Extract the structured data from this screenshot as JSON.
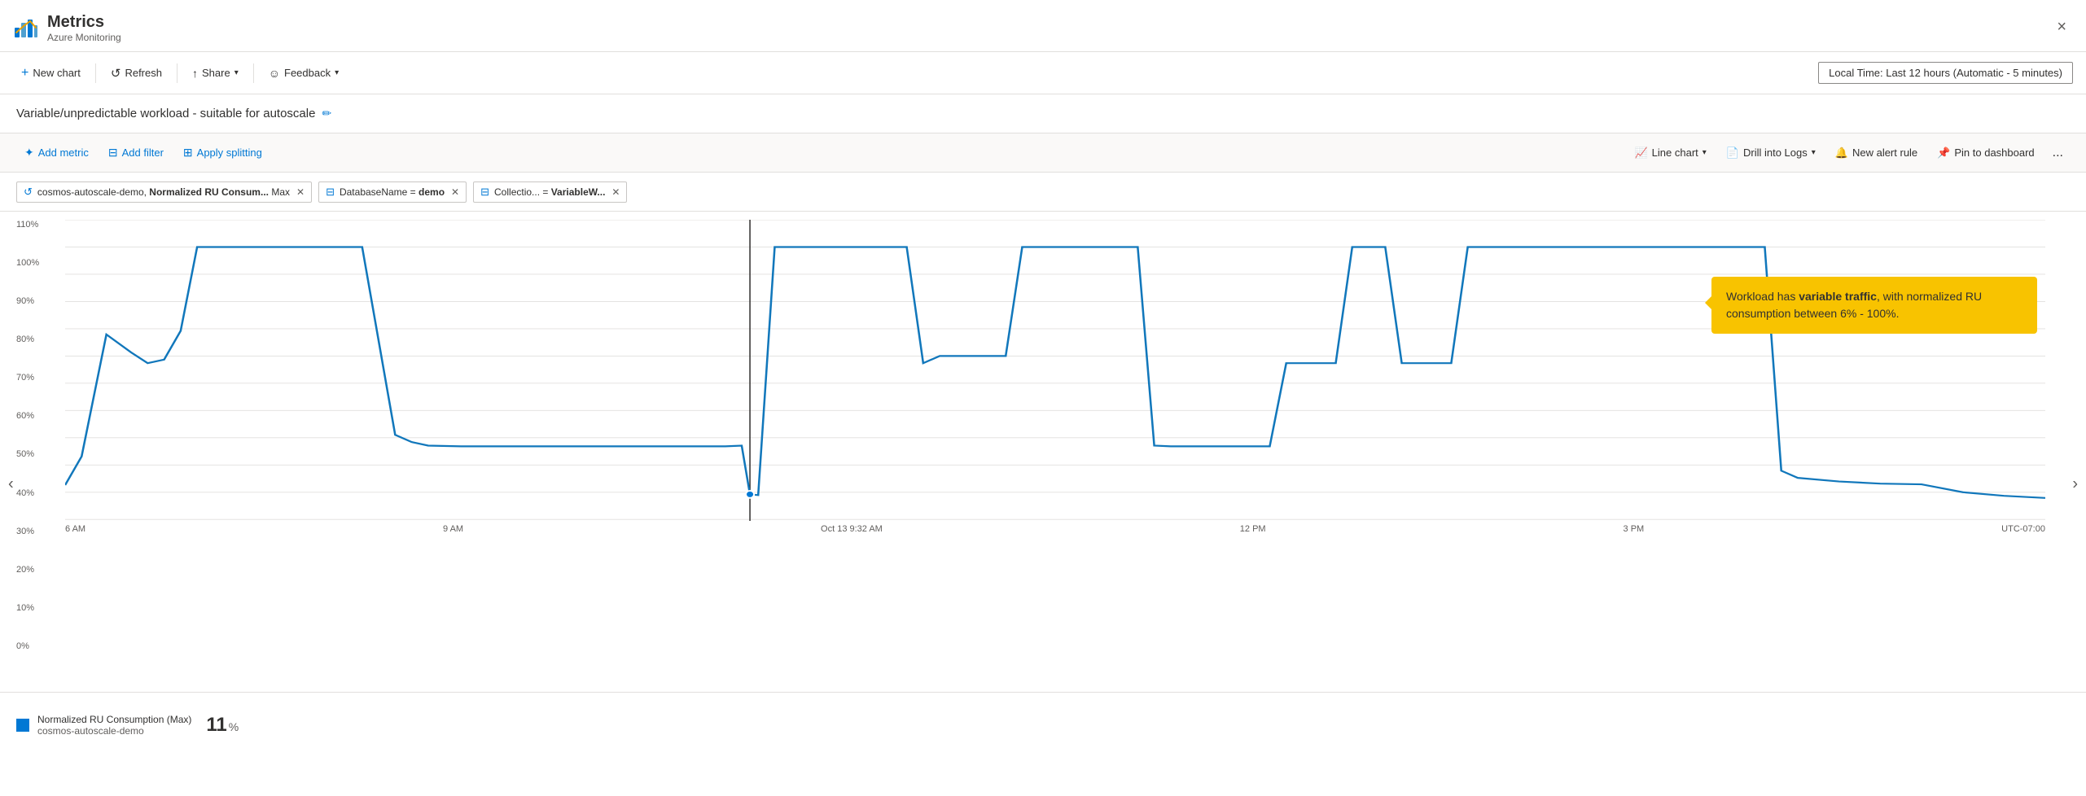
{
  "app": {
    "title": "Metrics",
    "subtitle": "Azure Monitoring",
    "close_label": "×"
  },
  "toolbar": {
    "new_chart": "New chart",
    "refresh": "Refresh",
    "share": "Share",
    "feedback": "Feedback",
    "time_range": "Local Time: Last 12 hours (Automatic - 5 minutes)"
  },
  "chart_title": {
    "text": "Variable/unpredictable workload - suitable for autoscale",
    "edit_icon": "✏"
  },
  "metrics_toolbar": {
    "add_metric": "Add metric",
    "add_filter": "Add filter",
    "apply_splitting": "Apply splitting",
    "line_chart": "Line chart",
    "drill_into_logs": "Drill into Logs",
    "new_alert_rule": "New alert rule",
    "pin_to_dashboard": "Pin to dashboard",
    "more": "..."
  },
  "filters": [
    {
      "type": "metric",
      "icon": "↺",
      "label": "cosmos-autoscale-demo, Normalized RU Consum... Max",
      "closable": true
    },
    {
      "type": "filter",
      "icon": "⊟",
      "label": "DatabaseName = ",
      "value": "demo",
      "closable": true
    },
    {
      "type": "filter",
      "icon": "⊟",
      "label": "Collectio... = ",
      "value": "VariableW...",
      "closable": true
    }
  ],
  "chart": {
    "y_labels": [
      "110%",
      "100%",
      "90%",
      "80%",
      "70%",
      "60%",
      "50%",
      "40%",
      "30%",
      "20%",
      "10%",
      "0%"
    ],
    "x_labels": [
      "6 AM",
      "9 AM",
      "Oct 13 9:32 AM",
      "12 PM",
      "3 PM",
      "UTC-07:00"
    ],
    "tooltip": {
      "text_before": "Workload has ",
      "bold": "variable traffic",
      "text_after": ", with normalized RU consumption between 6% - 100%."
    }
  },
  "legend": {
    "label": "Normalized RU Consumption (Max)",
    "sublabel": "cosmos-autoscale-demo",
    "value": "11",
    "unit": "%"
  },
  "nav": {
    "left": "‹",
    "right": "›"
  }
}
